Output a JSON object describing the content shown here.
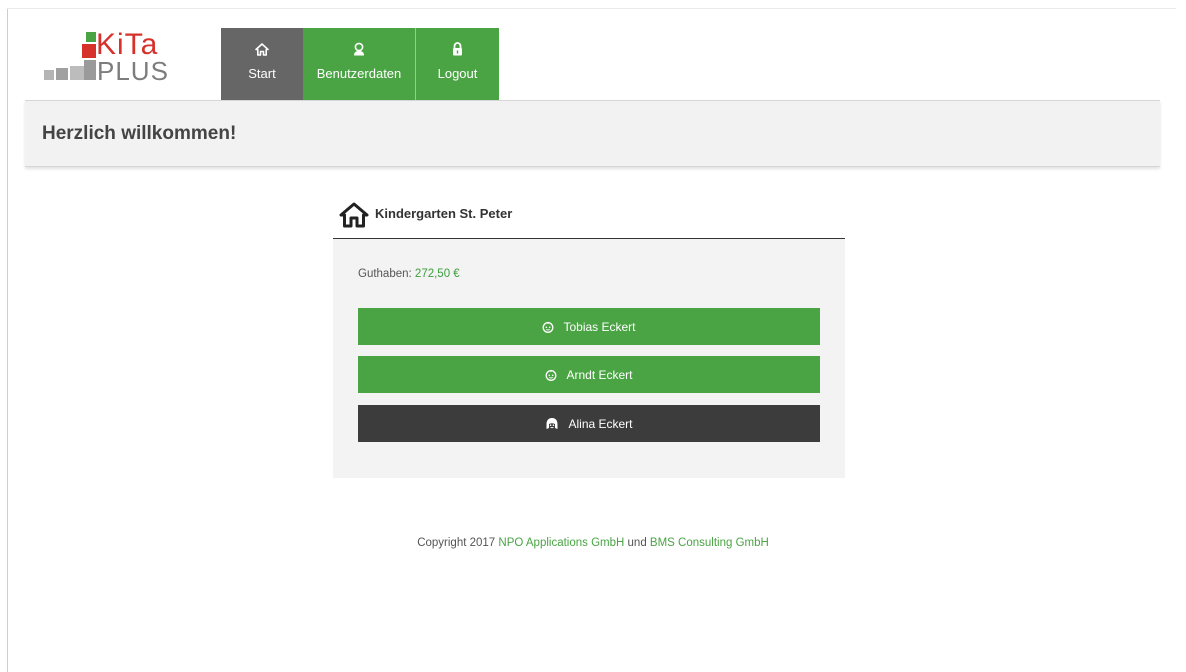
{
  "logo": {
    "line1_green": "K",
    "line1_red": "iTa",
    "line2": "PLUS"
  },
  "nav": {
    "items": [
      {
        "label": "Start",
        "icon": "home-icon"
      },
      {
        "label": "Benutzerdaten",
        "icon": "user-icon"
      },
      {
        "label": "Logout",
        "icon": "lock-icon"
      }
    ]
  },
  "welcome": {
    "title": "Herzlich willkommen!"
  },
  "kindergarten": {
    "name": "Kindergarten St. Peter",
    "balance_label": "Guthaben:",
    "balance_value": "272,50 €",
    "children": [
      {
        "name": "Tobias Eckert",
        "icon": "boy-face-icon",
        "state": "green"
      },
      {
        "name": "Arndt Eckert",
        "icon": "boy-face-icon",
        "state": "green"
      },
      {
        "name": "Alina Eckert",
        "icon": "girl-face-icon",
        "state": "dark"
      }
    ]
  },
  "footer": {
    "prefix": "Copyright 2017",
    "link1": "NPO Applications GmbH",
    "joiner": "und",
    "link2": "BMS Consulting GmbH"
  },
  "colors": {
    "green": "#4aa444",
    "dark": "#3c3c3c",
    "start_tab": "#666666",
    "logo_red": "#d6322b"
  }
}
